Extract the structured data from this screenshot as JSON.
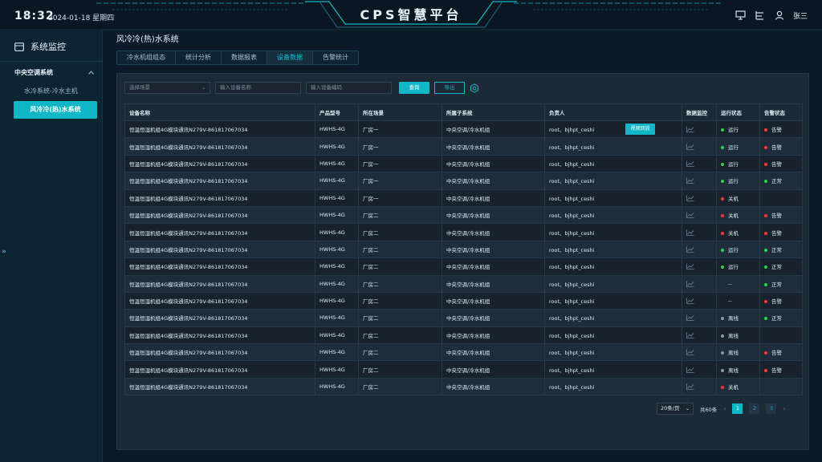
{
  "header": {
    "time": "18:32",
    "date": "2024-01-18 星期四",
    "brand": "CPS智慧平台",
    "user_name": "张三",
    "icons": [
      "monitor-icon",
      "hierarchy-icon",
      "user-icon"
    ]
  },
  "sidebar": {
    "title": "系统监控",
    "group_label": "中央空调系统",
    "items": [
      {
        "label": "水冷系统-冷水主机",
        "active": false
      },
      {
        "label": "风冷冷(热)水系统",
        "active": true
      }
    ],
    "toggle": "»"
  },
  "main": {
    "title": "风冷冷(热)水系统",
    "tabs": [
      {
        "label": "冷水机组组态",
        "active": false
      },
      {
        "label": "统计分析",
        "active": false
      },
      {
        "label": "数据报表",
        "active": false
      },
      {
        "label": "设备数据",
        "active": true
      },
      {
        "label": "告警统计",
        "active": false
      }
    ]
  },
  "filters": {
    "scene_placeholder": "选择场景",
    "name_placeholder": "输入设备名称",
    "code_placeholder": "输入设备编码",
    "search_label": "查询",
    "export_label": "导出"
  },
  "table": {
    "columns": [
      "设备名称",
      "产品型号",
      "所在场景",
      "所属子系统",
      "负责人",
      "数据监控",
      "运行状态",
      "告警状态"
    ],
    "replay_label": "视频回放",
    "rows": [
      [
        "恒温恒湿机组4G模块通讯N279V-861817067034",
        "HWHS-4G",
        "厂房一",
        "中央空调/冷水机组",
        "root、bjhpt_ceshi",
        "运行",
        "告警"
      ],
      [
        "恒温恒湿机组4G模块通讯N279V-861817067034",
        "HWHS-4G",
        "厂房一",
        "中央空调/冷水机组",
        "root、bjhpt_ceshi",
        "运行",
        "告警"
      ],
      [
        "恒温恒湿机组4G模块通讯N279V-861817067034",
        "HWHS-4G",
        "厂房一",
        "中央空调/冷水机组",
        "root、bjhpt_ceshi",
        "运行",
        "告警"
      ],
      [
        "恒温恒湿机组4G模块通讯N279V-861817067034",
        "HWHS-4G",
        "厂房一",
        "中央空调/冷水机组",
        "root、bjhpt_ceshi",
        "运行",
        "正常"
      ],
      [
        "恒温恒湿机组4G模块通讯N279V-861817067034",
        "HWHS-4G",
        "厂房一",
        "中央空调/冷水机组",
        "root、bjhpt_ceshi",
        "关机",
        ""
      ],
      [
        "恒温恒湿机组4G模块通讯N279V-861817067034",
        "HWHS-4G",
        "厂房二",
        "中央空调/冷水机组",
        "root、bjhpt_ceshi",
        "关机",
        "告警"
      ],
      [
        "恒温恒湿机组4G模块通讯N279V-861817067034",
        "HWHS-4G",
        "厂房二",
        "中央空调/冷水机组",
        "root、bjhpt_ceshi",
        "关机",
        "告警"
      ],
      [
        "恒温恒湿机组4G模块通讯N279V-861817067034",
        "HWHS-4G",
        "厂房二",
        "中央空调/冷水机组",
        "root、bjhpt_ceshi",
        "运行",
        "正常"
      ],
      [
        "恒温恒湿机组4G模块通讯N279V-861817067034",
        "HWHS-4G",
        "厂房二",
        "中央空调/冷水机组",
        "root、bjhpt_ceshi",
        "运行",
        "正常"
      ],
      [
        "恒温恒湿机组4G模块通讯N279V-861817067034",
        "HWHS-4G",
        "厂房二",
        "中央空调/冷水机组",
        "root、bjhpt_ceshi",
        "--",
        "正常"
      ],
      [
        "恒温恒湿机组4G模块通讯N279V-861817067034",
        "HWHS-4G",
        "厂房二",
        "中央空调/冷水机组",
        "root、bjhpt_ceshi",
        "--",
        "告警"
      ],
      [
        "恒温恒湿机组4G模块通讯N279V-861817067034",
        "HWHS-4G",
        "厂房二",
        "中央空调/冷水机组",
        "root、bjhpt_ceshi",
        "离线",
        "正常"
      ],
      [
        "恒温恒湿机组4G模块通讯N279V-861817067034",
        "HWHS-4G",
        "厂房二",
        "中央空调/冷水机组",
        "root、bjhpt_ceshi",
        "离线",
        ""
      ],
      [
        "恒温恒湿机组4G模块通讯N279V-861817067034",
        "HWHS-4G",
        "厂房二",
        "中央空调/冷水机组",
        "root、bjhpt_ceshi",
        "离线",
        "告警"
      ],
      [
        "恒温恒湿机组4G模块通讯N279V-861817067034",
        "HWHS-4G",
        "厂房二",
        "中央空调/冷水机组",
        "root、bjhpt_ceshi",
        "离线",
        "告警"
      ],
      [
        "恒温恒湿机组4G模块通讯N279V-861817067034",
        "HWHS-4G",
        "厂房二",
        "中央空调/冷水机组",
        "root、bjhpt_ceshi",
        "关机",
        ""
      ]
    ]
  },
  "status_colors": {
    "运行": "#2bd34a",
    "关机": "#ff3b3b",
    "离线": "#8a98a3",
    "告警": "#ff3b3b",
    "正常": "#2bd34a"
  },
  "pagination": {
    "page_size": "20条/页",
    "total": "共60条",
    "pages": [
      "1",
      "2",
      "3"
    ],
    "current": "1"
  }
}
